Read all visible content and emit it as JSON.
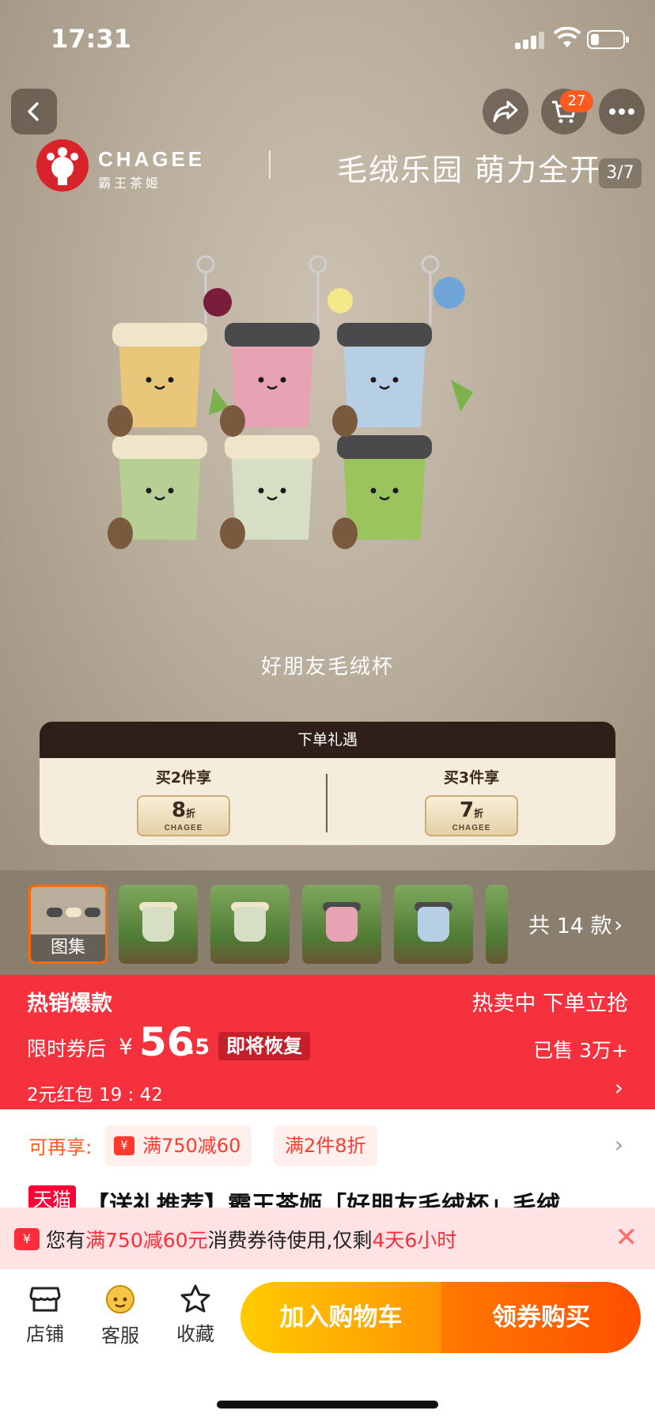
{
  "status": {
    "time": "17:31",
    "battery_level": 0.25
  },
  "header": {
    "cart_badge": "27",
    "page_indicator": "3/7"
  },
  "hero": {
    "brand_en": "CHAGEE",
    "brand_cn": "霸王茶姬",
    "slogan": "毛绒乐园 萌力全开",
    "caption": "好朋友毛绒杯"
  },
  "offer": {
    "heading": "下单礼遇",
    "left": {
      "title": "买2件享",
      "discount": "8",
      "unit": "折",
      "sub": "CHAGEE"
    },
    "right": {
      "title": "买3件享",
      "discount": "7",
      "unit": "折",
      "sub": "CHAGEE"
    }
  },
  "gallery": {
    "first_label": "图集",
    "variant_count": "共 14 款"
  },
  "price": {
    "tag": "热销爆款",
    "right_top": "热卖中 下单立抢",
    "label": "限时券后",
    "currency": "¥",
    "integer": "56",
    "decimal": ".5",
    "restore": "即将恢复",
    "sold": "已售 3万+",
    "coupon": "2元红包 19 : 42"
  },
  "promo": {
    "label": "可再享:",
    "chip1": "满750减60",
    "chip1_icon": "¥",
    "chip2": "满2件8折"
  },
  "title": {
    "badge": "天猫",
    "text": "【送礼推荐】霸王茶姬「好朋友毛绒杯」毛绒"
  },
  "voucher": {
    "icon": "¥",
    "prefix": "您有",
    "amount": "满750减60元",
    "middle": "消费券待使用,仅剩",
    "remaining": "4天6小时"
  },
  "bottom": {
    "store": "店铺",
    "service": "客服",
    "favorite": "收藏",
    "add_cart": "加入购物车",
    "buy": "领券购买"
  },
  "colors": {
    "accent": "#f5313d",
    "cart": "#ffb300",
    "buy": "#ff5a00",
    "brand": "#d8232a"
  }
}
